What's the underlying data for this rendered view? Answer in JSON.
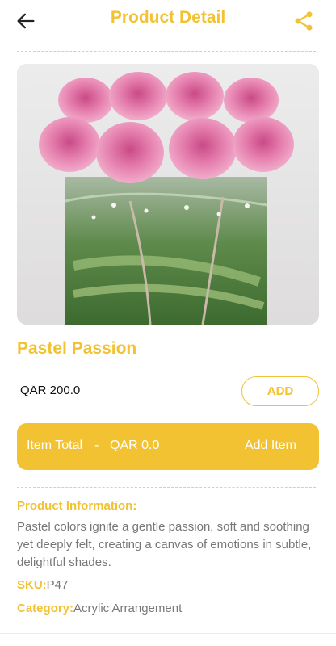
{
  "header": {
    "title": "Product Detail",
    "back_icon": "arrow-left-icon",
    "share_icon": "share-icon"
  },
  "colors": {
    "accent": "#F2C232",
    "text_gray": "#777777"
  },
  "product": {
    "name": "Pastel Passion",
    "price": "QAR 200.0",
    "add_label": "ADD"
  },
  "total_bar": {
    "label": "Item Total",
    "separator": "-",
    "value": "QAR 0.0",
    "action": "Add Item"
  },
  "info": {
    "heading": "Product Information:",
    "description": "Pastel colors ignite a gentle passion, soft and soothing yet deeply felt, creating a canvas of emotions in subtle, delightful shades.",
    "sku_label": "SKU:",
    "sku_value": "P47",
    "category_label": "Category:",
    "category_value": "Acrylic Arrangement"
  }
}
